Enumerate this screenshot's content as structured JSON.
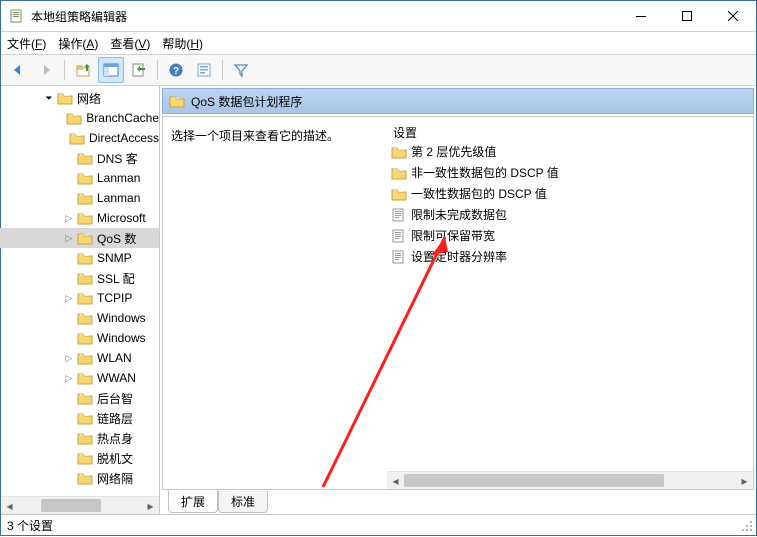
{
  "window": {
    "title": "本地组策略编辑器"
  },
  "menu": {
    "file": "文件(",
    "file_k": "F",
    "file2": ")",
    "action": "操作(",
    "action_k": "A",
    "action2": ")",
    "view": "查看(",
    "view_k": "V",
    "view2": ")",
    "help": "帮助(",
    "help_k": "H",
    "help2": ")"
  },
  "tree": {
    "root": "网络",
    "items": [
      "BranchCache",
      "DirectAccess",
      "DNS 客",
      "Lanman",
      "Lanman",
      "Microsoft",
      "QoS 数",
      "SNMP",
      "SSL 配",
      "TCPIP",
      "Windows",
      "Windows",
      "WLAN",
      "WWAN",
      "后台智",
      "链路层",
      "热点身",
      "脱机文",
      "网络隔"
    ],
    "expandable": [
      false,
      false,
      false,
      false,
      false,
      true,
      true,
      false,
      false,
      true,
      false,
      false,
      true,
      true,
      false,
      false,
      false,
      false,
      false
    ],
    "selected_index": 6
  },
  "header": {
    "title": "QoS 数据包计划程序"
  },
  "detail": {
    "hint": "选择一个项目来查看它的描述。",
    "column": "设置",
    "items": [
      {
        "type": "folder",
        "label": "第 2 层优先级值"
      },
      {
        "type": "folder",
        "label": "非一致性数据包的 DSCP 值"
      },
      {
        "type": "folder",
        "label": "一致性数据包的 DSCP 值"
      },
      {
        "type": "setting",
        "label": "限制未完成数据包"
      },
      {
        "type": "setting",
        "label": "限制可保留带宽"
      },
      {
        "type": "setting",
        "label": "设置定时器分辨率"
      }
    ]
  },
  "tabs": {
    "extended": "扩展",
    "standard": "标准"
  },
  "status": {
    "text": "3 个设置"
  }
}
